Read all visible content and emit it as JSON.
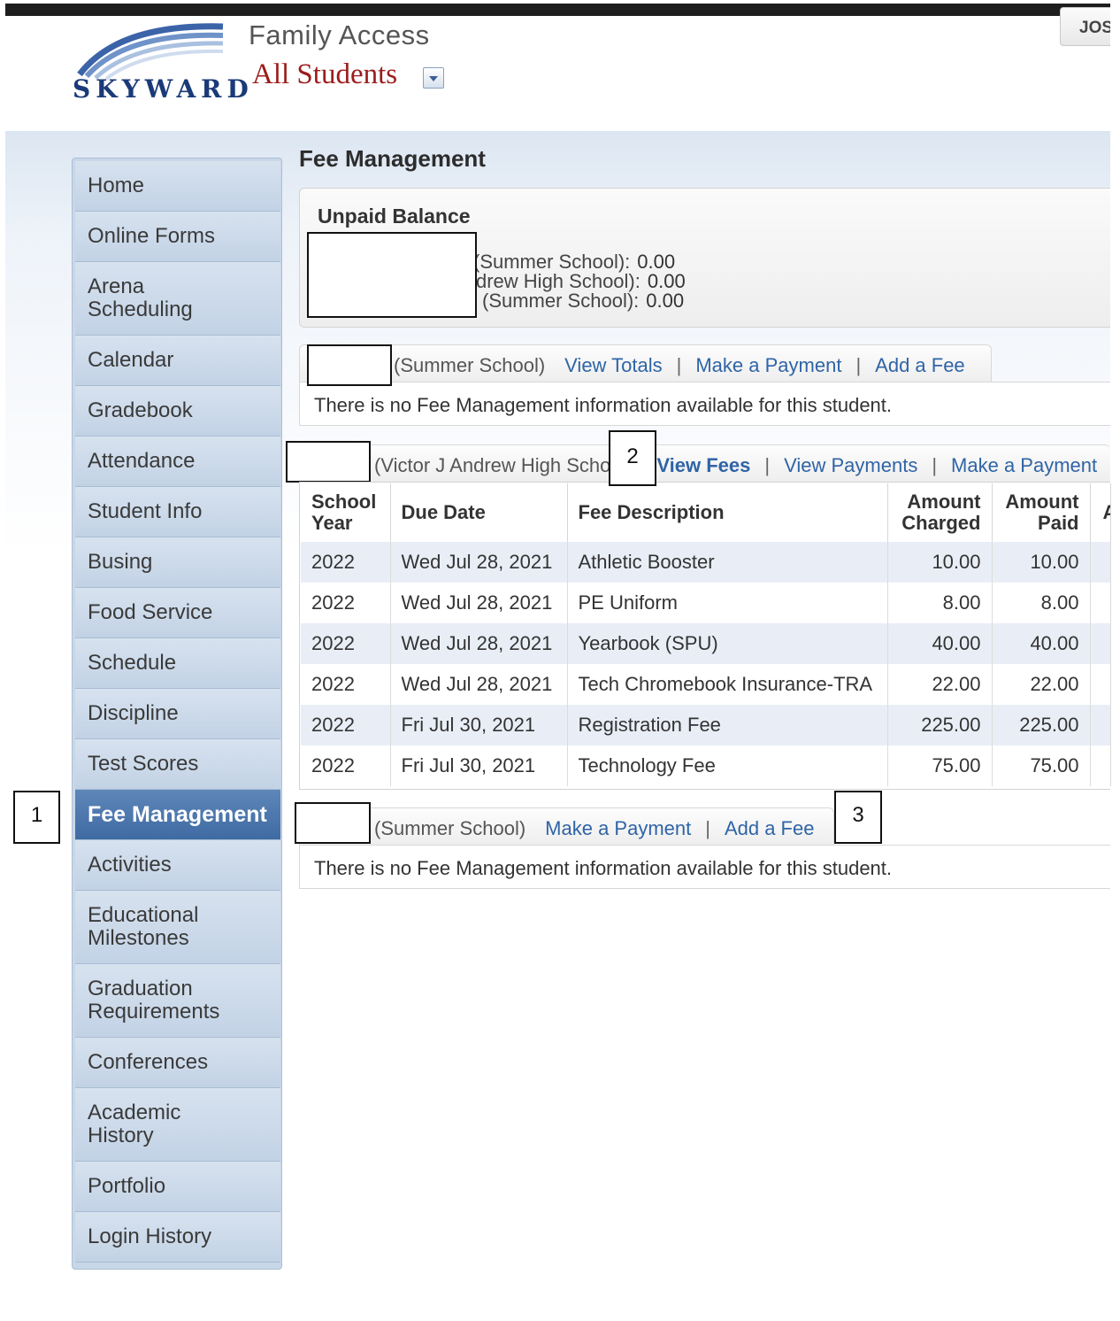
{
  "header": {
    "brand": "SKYWARD",
    "app_title": "Family Access",
    "student_selector": "All Students",
    "user_button": "JOS"
  },
  "sidebar": {
    "items": [
      {
        "label": "Home"
      },
      {
        "label": "Online Forms"
      },
      {
        "label": "Arena Scheduling"
      },
      {
        "label": "Calendar"
      },
      {
        "label": "Gradebook"
      },
      {
        "label": "Attendance"
      },
      {
        "label": "Student Info"
      },
      {
        "label": "Busing"
      },
      {
        "label": "Food Service"
      },
      {
        "label": "Schedule"
      },
      {
        "label": "Discipline"
      },
      {
        "label": "Test Scores"
      },
      {
        "label": "Fee Management"
      },
      {
        "label": "Activities"
      },
      {
        "label": "Educational Milestones"
      },
      {
        "label": "Graduation Requirements"
      },
      {
        "label": "Conferences"
      },
      {
        "label": "Academic History"
      },
      {
        "label": "Portfolio"
      },
      {
        "label": "Login History"
      }
    ],
    "active": "Fee Management"
  },
  "main": {
    "page_title": "Fee Management",
    "unpaid_balance": {
      "title": "Unpaid Balance",
      "lines": [
        {
          "label": "(Summer School):",
          "value": "0.00"
        },
        {
          "label": "drew High School):",
          "value": "0.00"
        },
        {
          "label": "(Summer School):",
          "value": "0.00"
        }
      ]
    },
    "section1": {
      "school": "(Summer School)",
      "links": [
        "View Totals",
        "Make a Payment",
        "Add a Fee"
      ],
      "message": "There is no Fee Management information available for this student."
    },
    "section2": {
      "school": "(Victor J Andrew High Scho",
      "links": [
        "View Fees",
        "View Payments",
        "Make a Payment"
      ],
      "table": {
        "headers": [
          "School Year",
          "Due Date",
          "Fee Description",
          "Amount Charged",
          "Amount Paid",
          "A"
        ],
        "rows": [
          [
            "2022",
            "Wed Jul 28, 2021",
            "Athletic Booster",
            "10.00",
            "10.00"
          ],
          [
            "2022",
            "Wed Jul 28, 2021",
            "PE Uniform",
            "8.00",
            "8.00"
          ],
          [
            "2022",
            "Wed Jul 28, 2021",
            "Yearbook (SPU)",
            "40.00",
            "40.00"
          ],
          [
            "2022",
            "Wed Jul 28, 2021",
            "Tech Chromebook Insurance-TRA",
            "22.00",
            "22.00"
          ],
          [
            "2022",
            "Fri Jul 30, 2021",
            "Registration Fee",
            "225.00",
            "225.00"
          ],
          [
            "2022",
            "Fri Jul 30, 2021",
            "Technology Fee",
            "75.00",
            "75.00"
          ]
        ]
      }
    },
    "section3": {
      "school": "(Summer School)",
      "links": [
        "Make a Payment",
        "Add a Fee"
      ],
      "message": "There is no Fee Management information available for this student."
    }
  },
  "callouts": [
    "1",
    "2",
    "3"
  ]
}
